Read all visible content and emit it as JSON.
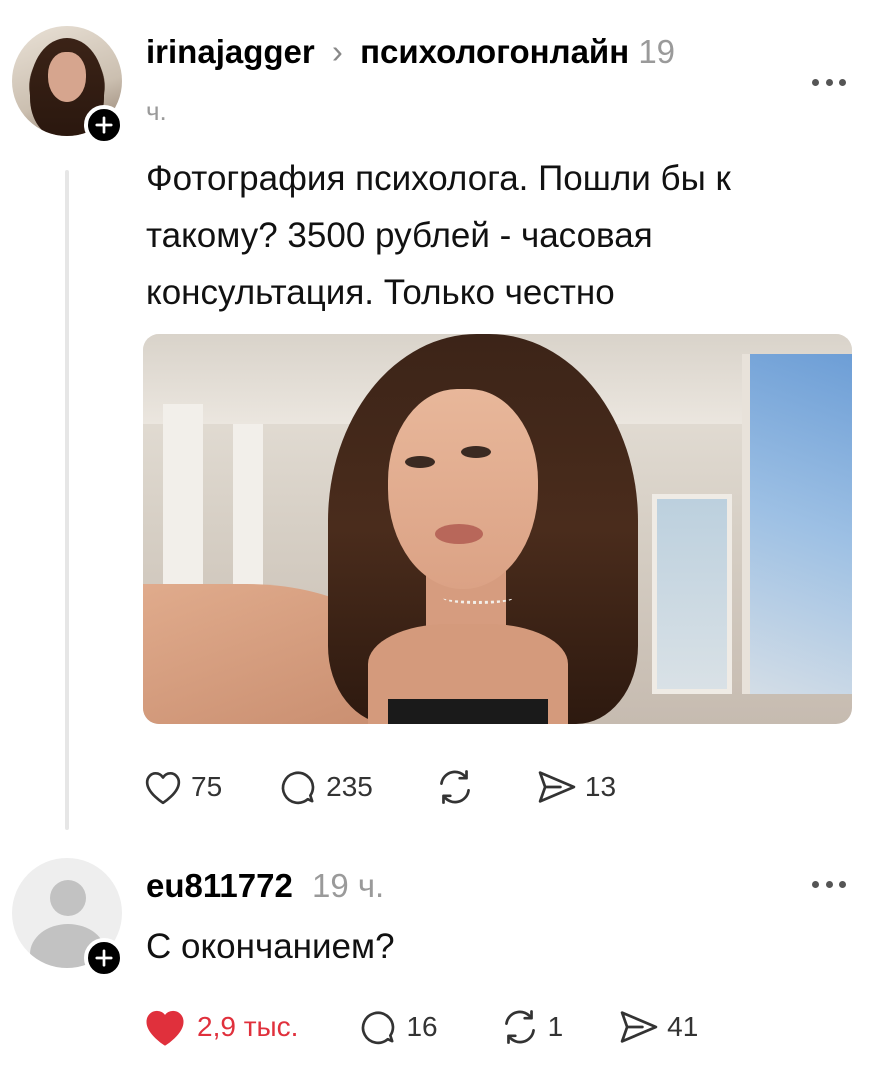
{
  "post": {
    "username": "irinajagger",
    "separator": "›",
    "community": "психологонлайн",
    "time_value": "19",
    "time_unit": "ч.",
    "text": "Фотография психолога. Пошли бы к такому? 3500 рублей - часовая консультация. Только честно",
    "actions": {
      "likes": "75",
      "comments": "235",
      "reposts": "",
      "shares": "13"
    }
  },
  "reply": {
    "username": "eu811772",
    "time": "19 ч.",
    "text": "С окончанием?",
    "actions": {
      "likes": "2,9 тыс.",
      "comments": "16",
      "reposts": "1",
      "shares": "41"
    }
  },
  "colors": {
    "like_active": "#e0303c",
    "icon_gray": "#333333",
    "time_gray": "#9a9a9a",
    "thread_line": "#e6e6e6"
  },
  "icons": [
    "plus-icon",
    "more-icon",
    "heart-icon",
    "comment-icon",
    "repost-icon",
    "share-icon"
  ]
}
